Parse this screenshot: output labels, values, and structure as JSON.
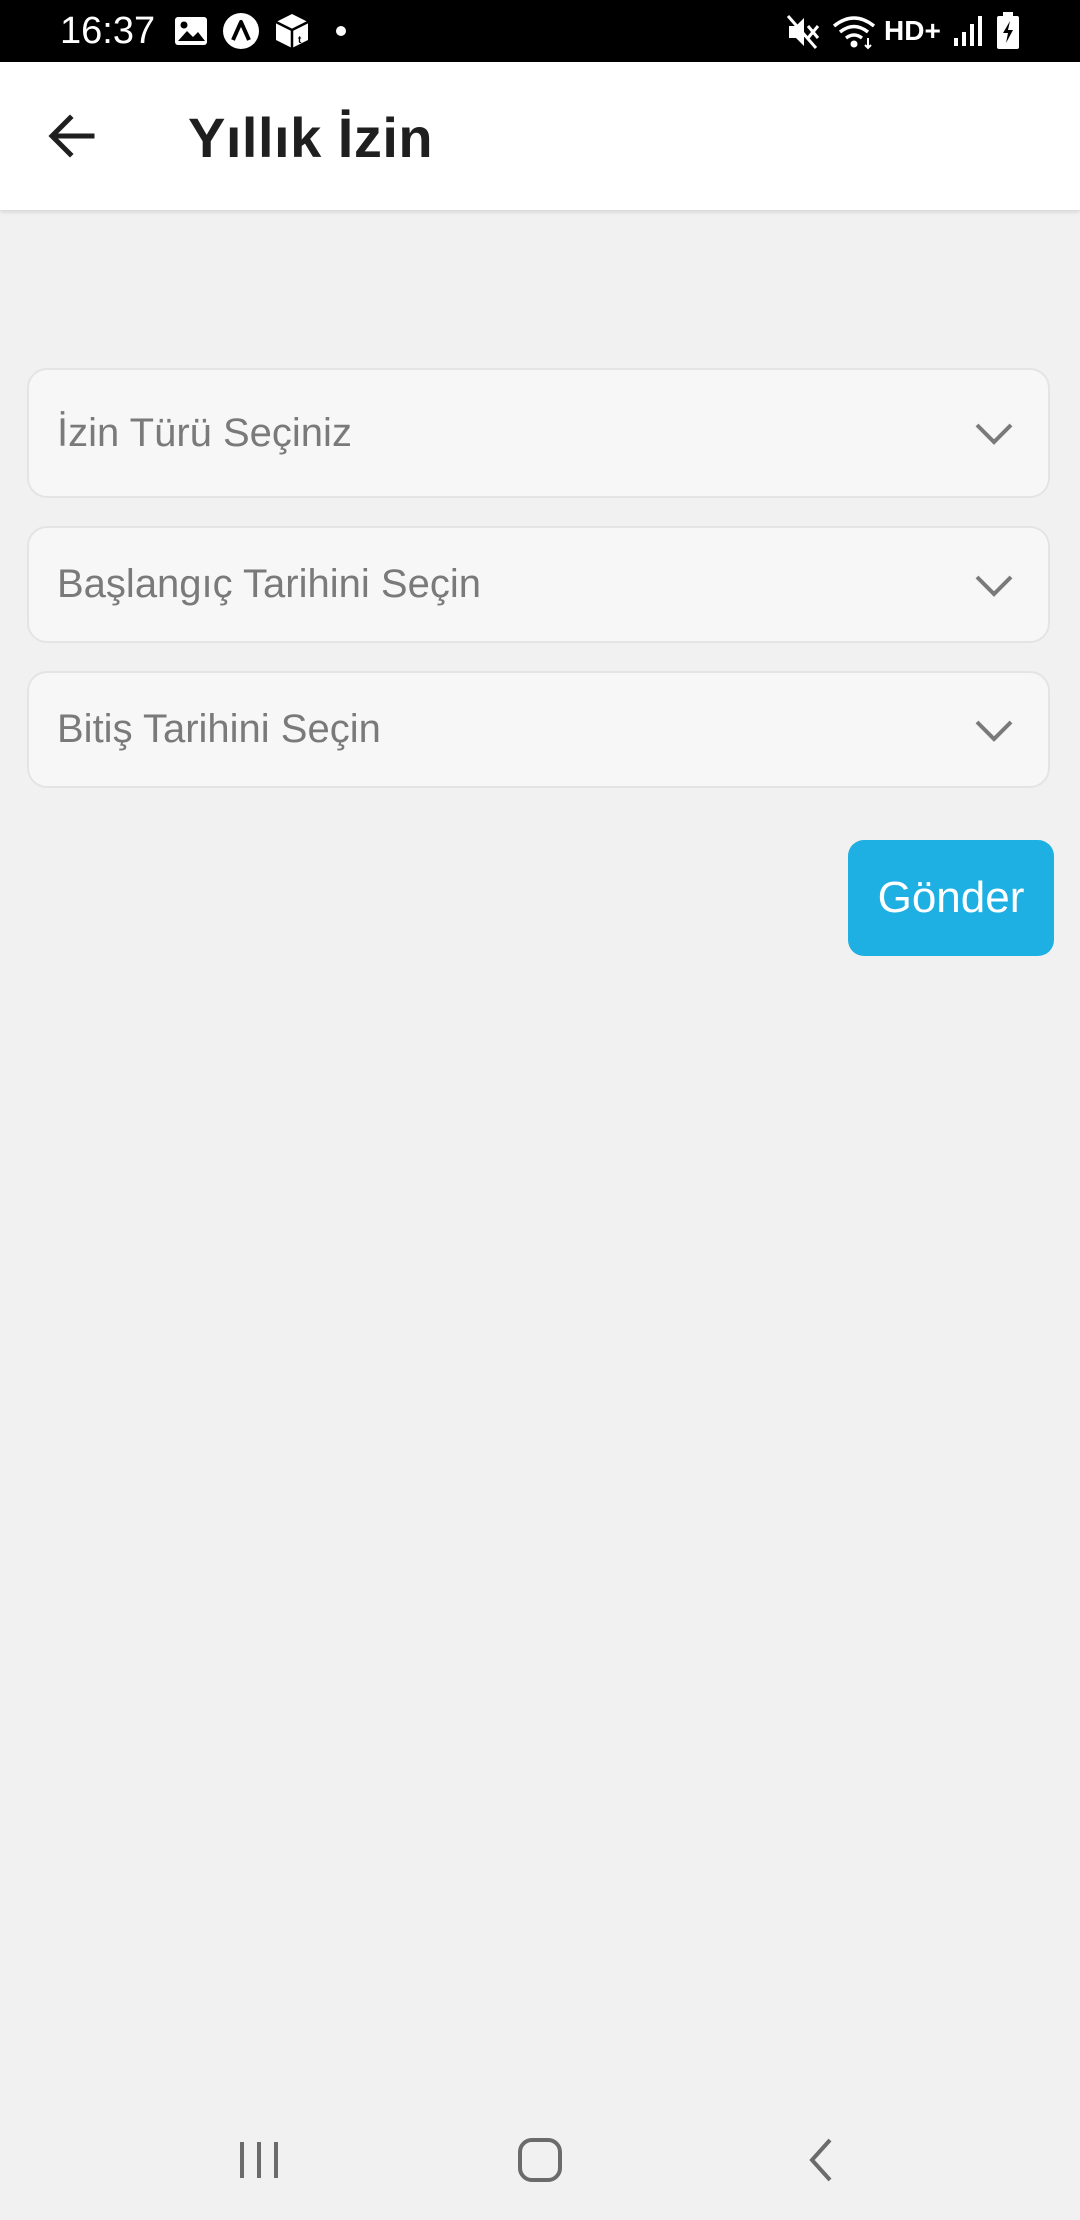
{
  "status_bar": {
    "time": "16:37",
    "network_label": "HD+",
    "icons": [
      "gallery-icon",
      "app-notification-icon",
      "package-icon",
      "notification-dot-icon",
      "mute-icon",
      "wifi-icon",
      "signal-icon",
      "battery-charging-icon"
    ]
  },
  "app_bar": {
    "title": "Yıllık İzin",
    "back_icon": "arrow-left-icon"
  },
  "form": {
    "leave_type_placeholder": "İzin Türü Seçiniz",
    "start_date_placeholder": "Başlangıç Tarihini Seçin",
    "end_date_placeholder": "Bitiş Tarihini Seçin",
    "submit_label": "Gönder"
  },
  "nav_bar": {
    "buttons": [
      "recent-apps-icon",
      "home-icon",
      "back-icon"
    ]
  },
  "colors": {
    "accent": "#1fb0e3",
    "background": "#f1f1f1",
    "status_bar": "#000000",
    "app_bar": "#ffffff",
    "field_background": "#f7f7f7",
    "placeholder_text": "#7a7a7a"
  }
}
